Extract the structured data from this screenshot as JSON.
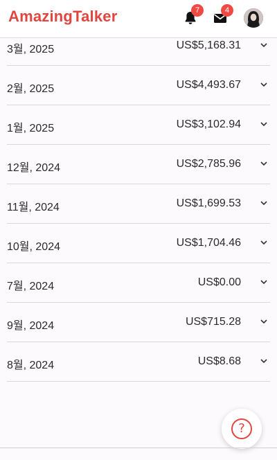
{
  "header": {
    "logo": "AmazingTalker",
    "notifications_count": "7",
    "messages_count": "4",
    "bell_icon": "bell-icon",
    "mail_icon": "mail-icon",
    "brand_color": "#e0463f",
    "badge_color": "#ef4a44"
  },
  "earnings": [
    {
      "month": "3월, 2025",
      "amount": "US$5,168.31"
    },
    {
      "month": "2월, 2025",
      "amount": "US$4,493.67"
    },
    {
      "month": "1월, 2025",
      "amount": "US$3,102.94"
    },
    {
      "month": "12월, 2024",
      "amount": "US$2,785.96"
    },
    {
      "month": "11월, 2024",
      "amount": "US$1,699.53"
    },
    {
      "month": "10월, 2024",
      "amount": "US$1,704.46"
    },
    {
      "month": "7월, 2024",
      "amount": "US$0.00"
    },
    {
      "month": "9월, 2024",
      "amount": "US$715.28"
    },
    {
      "month": "8월, 2024",
      "amount": "US$8.68"
    }
  ],
  "help_button": {
    "symbol": "?",
    "icon": "question-icon"
  }
}
